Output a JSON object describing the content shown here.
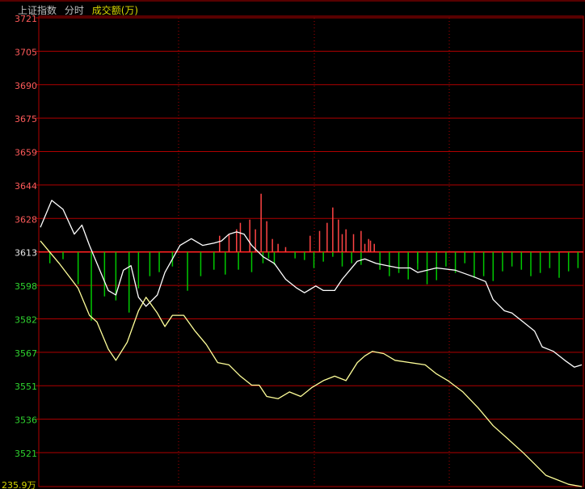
{
  "header": {
    "index_name": "上证指数",
    "period": "分时",
    "volume_label": "成交额(万)"
  },
  "colors": {
    "background": "#000000",
    "grid": "#b00000",
    "up": "#ff4444",
    "down": "#00c800",
    "flat": "#e8e8e8",
    "index_line": "#ffffff",
    "average_line": "#ffff99"
  },
  "chart_data": {
    "type": "line",
    "title": "上证指数 分时 成交额(万)",
    "base_price": 3613,
    "ylim": [
      3513,
      3721
    ],
    "y_ticks": [
      "3721",
      "3705",
      "3690",
      "3675",
      "3659",
      "3644",
      "3628",
      "3613",
      "3598",
      "3582",
      "3567",
      "3551",
      "3536",
      "3521"
    ],
    "volume_axis_label": "235.9万",
    "grid": true,
    "series": [
      {
        "color": "#ffffff",
        "points": [
          [
            0,
            3628
          ],
          [
            6,
            3640
          ],
          [
            12,
            3636
          ],
          [
            18,
            3625
          ],
          [
            22,
            3629
          ],
          [
            26,
            3620
          ],
          [
            30,
            3612
          ],
          [
            36,
            3600
          ],
          [
            40,
            3598
          ],
          [
            44,
            3609
          ],
          [
            48,
            3611
          ],
          [
            52,
            3597
          ],
          [
            56,
            3593
          ],
          [
            62,
            3598
          ],
          [
            66,
            3608
          ],
          [
            70,
            3614
          ],
          [
            74,
            3620
          ],
          [
            80,
            3623
          ],
          [
            86,
            3620
          ],
          [
            92,
            3621
          ],
          [
            96,
            3622
          ],
          [
            100,
            3625
          ],
          [
            104,
            3626
          ],
          [
            108,
            3625
          ],
          [
            112,
            3620
          ],
          [
            118,
            3615
          ],
          [
            124,
            3612
          ],
          [
            130,
            3605
          ],
          [
            136,
            3601
          ],
          [
            140,
            3599
          ],
          [
            146,
            3602
          ],
          [
            150,
            3600
          ],
          [
            156,
            3600
          ],
          [
            160,
            3605
          ],
          [
            164,
            3609
          ],
          [
            168,
            3613
          ],
          [
            172,
            3614
          ],
          [
            178,
            3612
          ],
          [
            184,
            3611
          ],
          [
            190,
            3610
          ],
          [
            196,
            3610
          ],
          [
            200,
            3608
          ],
          [
            210,
            3610
          ],
          [
            220,
            3609
          ],
          [
            230,
            3606
          ],
          [
            236,
            3604
          ],
          [
            240,
            3596
          ],
          [
            246,
            3591
          ],
          [
            250,
            3590
          ],
          [
            256,
            3586
          ],
          [
            262,
            3582
          ],
          [
            266,
            3575
          ],
          [
            272,
            3573
          ],
          [
            278,
            3569
          ],
          [
            283,
            3566
          ],
          [
            287,
            3567
          ]
        ]
      },
      {
        "color": "#ffff99",
        "points": [
          [
            0,
            3622
          ],
          [
            10,
            3612
          ],
          [
            20,
            3601
          ],
          [
            26,
            3589
          ],
          [
            30,
            3586
          ],
          [
            36,
            3574
          ],
          [
            40,
            3569
          ],
          [
            46,
            3577
          ],
          [
            52,
            3591
          ],
          [
            56,
            3597
          ],
          [
            62,
            3590
          ],
          [
            66,
            3584
          ],
          [
            70,
            3589
          ],
          [
            76,
            3589
          ],
          [
            82,
            3582
          ],
          [
            88,
            3576
          ],
          [
            94,
            3568
          ],
          [
            100,
            3567
          ],
          [
            106,
            3562
          ],
          [
            112,
            3558
          ],
          [
            116,
            3558
          ],
          [
            120,
            3553
          ],
          [
            126,
            3552
          ],
          [
            132,
            3555
          ],
          [
            138,
            3553
          ],
          [
            144,
            3557
          ],
          [
            150,
            3560
          ],
          [
            156,
            3562
          ],
          [
            162,
            3560
          ],
          [
            168,
            3568
          ],
          [
            172,
            3571
          ],
          [
            176,
            3573
          ],
          [
            182,
            3572
          ],
          [
            188,
            3569
          ],
          [
            196,
            3568
          ],
          [
            204,
            3567
          ],
          [
            210,
            3563
          ],
          [
            216,
            3560
          ],
          [
            224,
            3555
          ],
          [
            232,
            3548
          ],
          [
            240,
            3540
          ],
          [
            248,
            3534
          ],
          [
            256,
            3528
          ],
          [
            262,
            3523
          ],
          [
            268,
            3518
          ],
          [
            274,
            3516
          ],
          [
            280,
            3514
          ],
          [
            287,
            3513
          ]
        ]
      }
    ]
  }
}
